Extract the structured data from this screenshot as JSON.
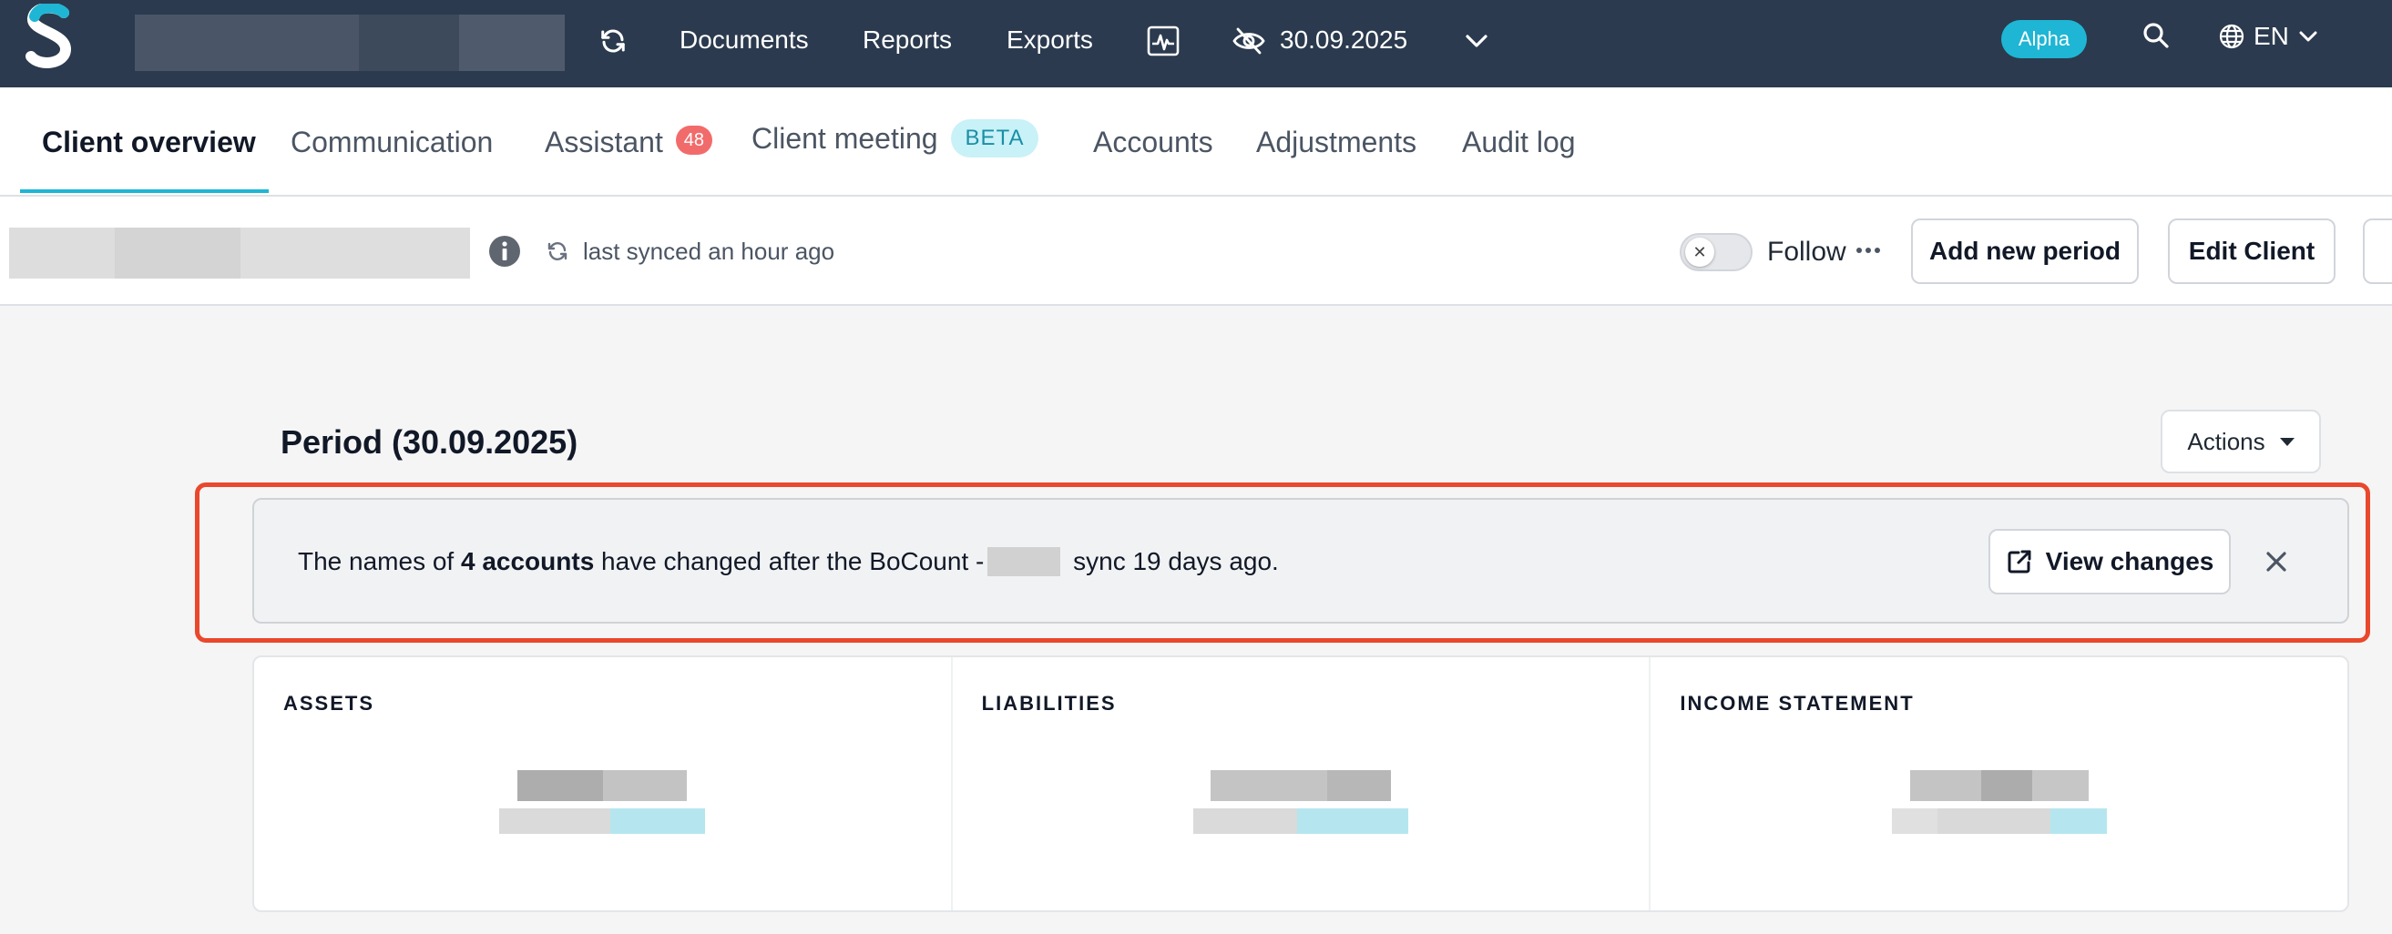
{
  "topbar": {
    "nav": [
      "Documents",
      "Reports",
      "Exports"
    ],
    "date": "30.09.2025",
    "alpha_badge": "Alpha",
    "language": "EN"
  },
  "tabs": [
    {
      "label": "Client overview",
      "active": true
    },
    {
      "label": "Communication"
    },
    {
      "label": "Assistant",
      "badge": "48"
    },
    {
      "label": "Client meeting",
      "badge": "BETA"
    },
    {
      "label": "Accounts"
    },
    {
      "label": "Adjustments"
    },
    {
      "label": "Audit log"
    }
  ],
  "subheader": {
    "sync_status": "last synced an hour ago",
    "follow_label": "Follow",
    "add_period_label": "Add new period",
    "edit_client_label": "Edit Client"
  },
  "period": {
    "title": "Period (30.09.2025)",
    "actions_label": "Actions"
  },
  "banner": {
    "prefix": "The names of ",
    "bold": "4 accounts",
    "middle": " have changed after the BoCount -",
    "suffix": " sync 19 days ago.",
    "view_changes_label": "View changes"
  },
  "cards": [
    {
      "title": "ASSETS"
    },
    {
      "title": "LIABILITIES"
    },
    {
      "title": "INCOME STATEMENT"
    }
  ],
  "colors": {
    "topbar": "#2b3a4e",
    "accent": "#1eb6d4",
    "highlight_border": "#e9482c",
    "count_badge": "#f26b6b"
  }
}
